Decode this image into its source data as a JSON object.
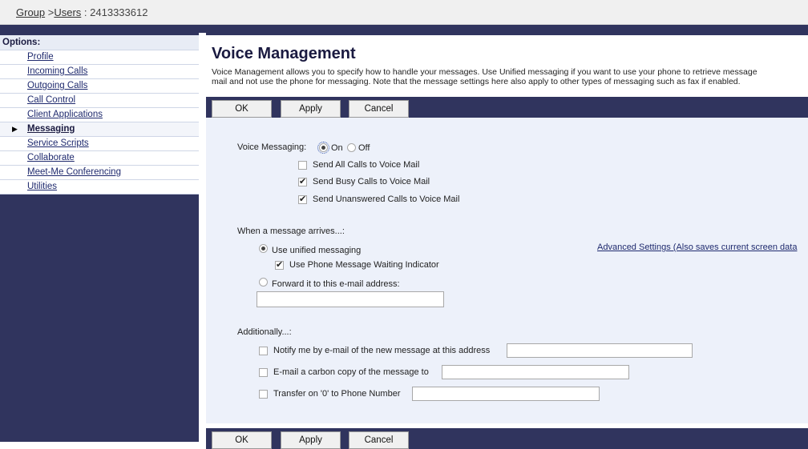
{
  "breadcrumb": {
    "group": "Group",
    "separator1": " >",
    "users": "Users",
    "separator2": " : ",
    "user_id": "2413333612"
  },
  "sidebar": {
    "title": "Options:",
    "items": [
      {
        "label": "Profile"
      },
      {
        "label": "Incoming Calls"
      },
      {
        "label": "Outgoing Calls"
      },
      {
        "label": "Call Control"
      },
      {
        "label": "Client Applications"
      },
      {
        "label": "Messaging"
      },
      {
        "label": "Service Scripts"
      },
      {
        "label": "Collaborate"
      },
      {
        "label": "Meet-Me Conferencing"
      },
      {
        "label": "Utilities"
      }
    ],
    "active_item": "Messaging"
  },
  "page": {
    "title": "Voice Management",
    "description_line1": "Voice Management allows you to specify how to handle your messages. Use Unified messaging if you want to use your phone to retrieve message",
    "description_line2": "mail and not use the phone for messaging. Note that the message settings here also apply to other types of messaging such as fax if enabled."
  },
  "buttons": {
    "ok": "OK",
    "apply": "Apply",
    "cancel": "Cancel"
  },
  "voice_messaging": {
    "label": "Voice Messaging:",
    "on_label": "On",
    "off_label": "Off",
    "selected": "On",
    "send_all_calls": {
      "label": "Send All Calls to Voice Mail",
      "checked": false
    },
    "send_busy_calls": {
      "label": "Send Busy Calls to Voice Mail",
      "checked": true
    },
    "send_unanswered_calls": {
      "label": "Send Unanswered Calls to Voice Mail",
      "checked": true
    }
  },
  "message_arrives": {
    "label": "When a message arrives...:",
    "unified_label": "Use unified messaging",
    "selected": "unified",
    "advanced_link": "Advanced Settings (Also saves current screen data",
    "mwi": {
      "label": "Use Phone Message Waiting Indicator",
      "checked": true
    },
    "forward_label": "Forward it to this e-mail address:",
    "forward_email_value": ""
  },
  "additionally": {
    "label": "Additionally...:",
    "notify": {
      "label": "Notify me by e-mail of the new message at this address",
      "checked": false,
      "value": ""
    },
    "carbon_copy": {
      "label": "E-mail a carbon copy of the message to",
      "checked": false,
      "value": ""
    },
    "transfer": {
      "label": "Transfer on '0' to Phone Number",
      "checked": false,
      "value": ""
    }
  },
  "colors": {
    "navy": "#30345e",
    "form_bg": "#edf1fa",
    "link": "#1f2a6e"
  }
}
